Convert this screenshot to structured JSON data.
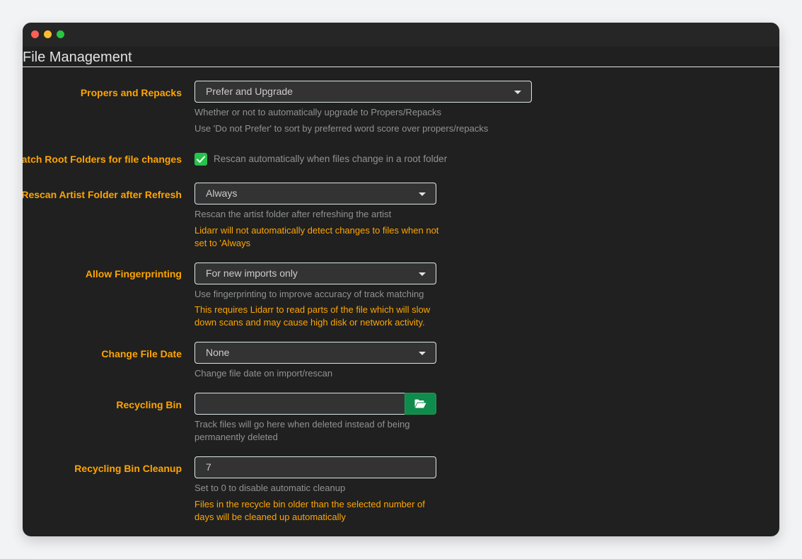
{
  "window": {
    "title": "File Management",
    "controls": [
      "close",
      "minimize",
      "maximize"
    ]
  },
  "fields": {
    "propers": {
      "label": "Propers and Repacks",
      "value": "Prefer and Upgrade",
      "help": [
        "Whether or not to automatically upgrade to Propers/Repacks",
        "Use 'Do not Prefer' to sort by preferred word score over propers/repacks"
      ]
    },
    "watch_root": {
      "label": "Watch Root Folders for file changes",
      "checked": true,
      "text": "Rescan automatically when files change in a root folder"
    },
    "rescan": {
      "label": "Rescan Artist Folder after Refresh",
      "value": "Always",
      "help": "Rescan the artist folder after refreshing the artist",
      "warning_1": "Lidarr will not automatically detect changes to files when not",
      "warning_2": "set to 'Always"
    },
    "fingerprinting": {
      "label": "Allow Fingerprinting",
      "value": "For new imports only",
      "help": "Use fingerprinting to improve accuracy of track matching",
      "warning_1": "This requires Lidarr to read parts of the file which will slow",
      "warning_2": "down scans and may cause high disk or network activity."
    },
    "file_date": {
      "label": "Change File Date",
      "value": "None",
      "help": "Change file date on import/rescan"
    },
    "recycling_bin": {
      "label": "Recycling Bin",
      "value": "",
      "help_1": "Track files will go here when deleted instead of being",
      "help_2": "permanently deleted"
    },
    "recycling_cleanup": {
      "label": "Recycling Bin Cleanup",
      "value": "7",
      "help": "Set to 0 to disable automatic cleanup",
      "warning_1": "Files in the recycle bin older than the selected number of",
      "warning_2": "days will be cleaned up automatically"
    }
  },
  "icons": {
    "check": "check-icon",
    "folder": "folder-open-icon",
    "caret": "caret-down-icon"
  },
  "colors": {
    "accent_label": "#ffa500",
    "success": "#27c24c",
    "button_green": "#0f8b4c",
    "background": "#202020"
  }
}
